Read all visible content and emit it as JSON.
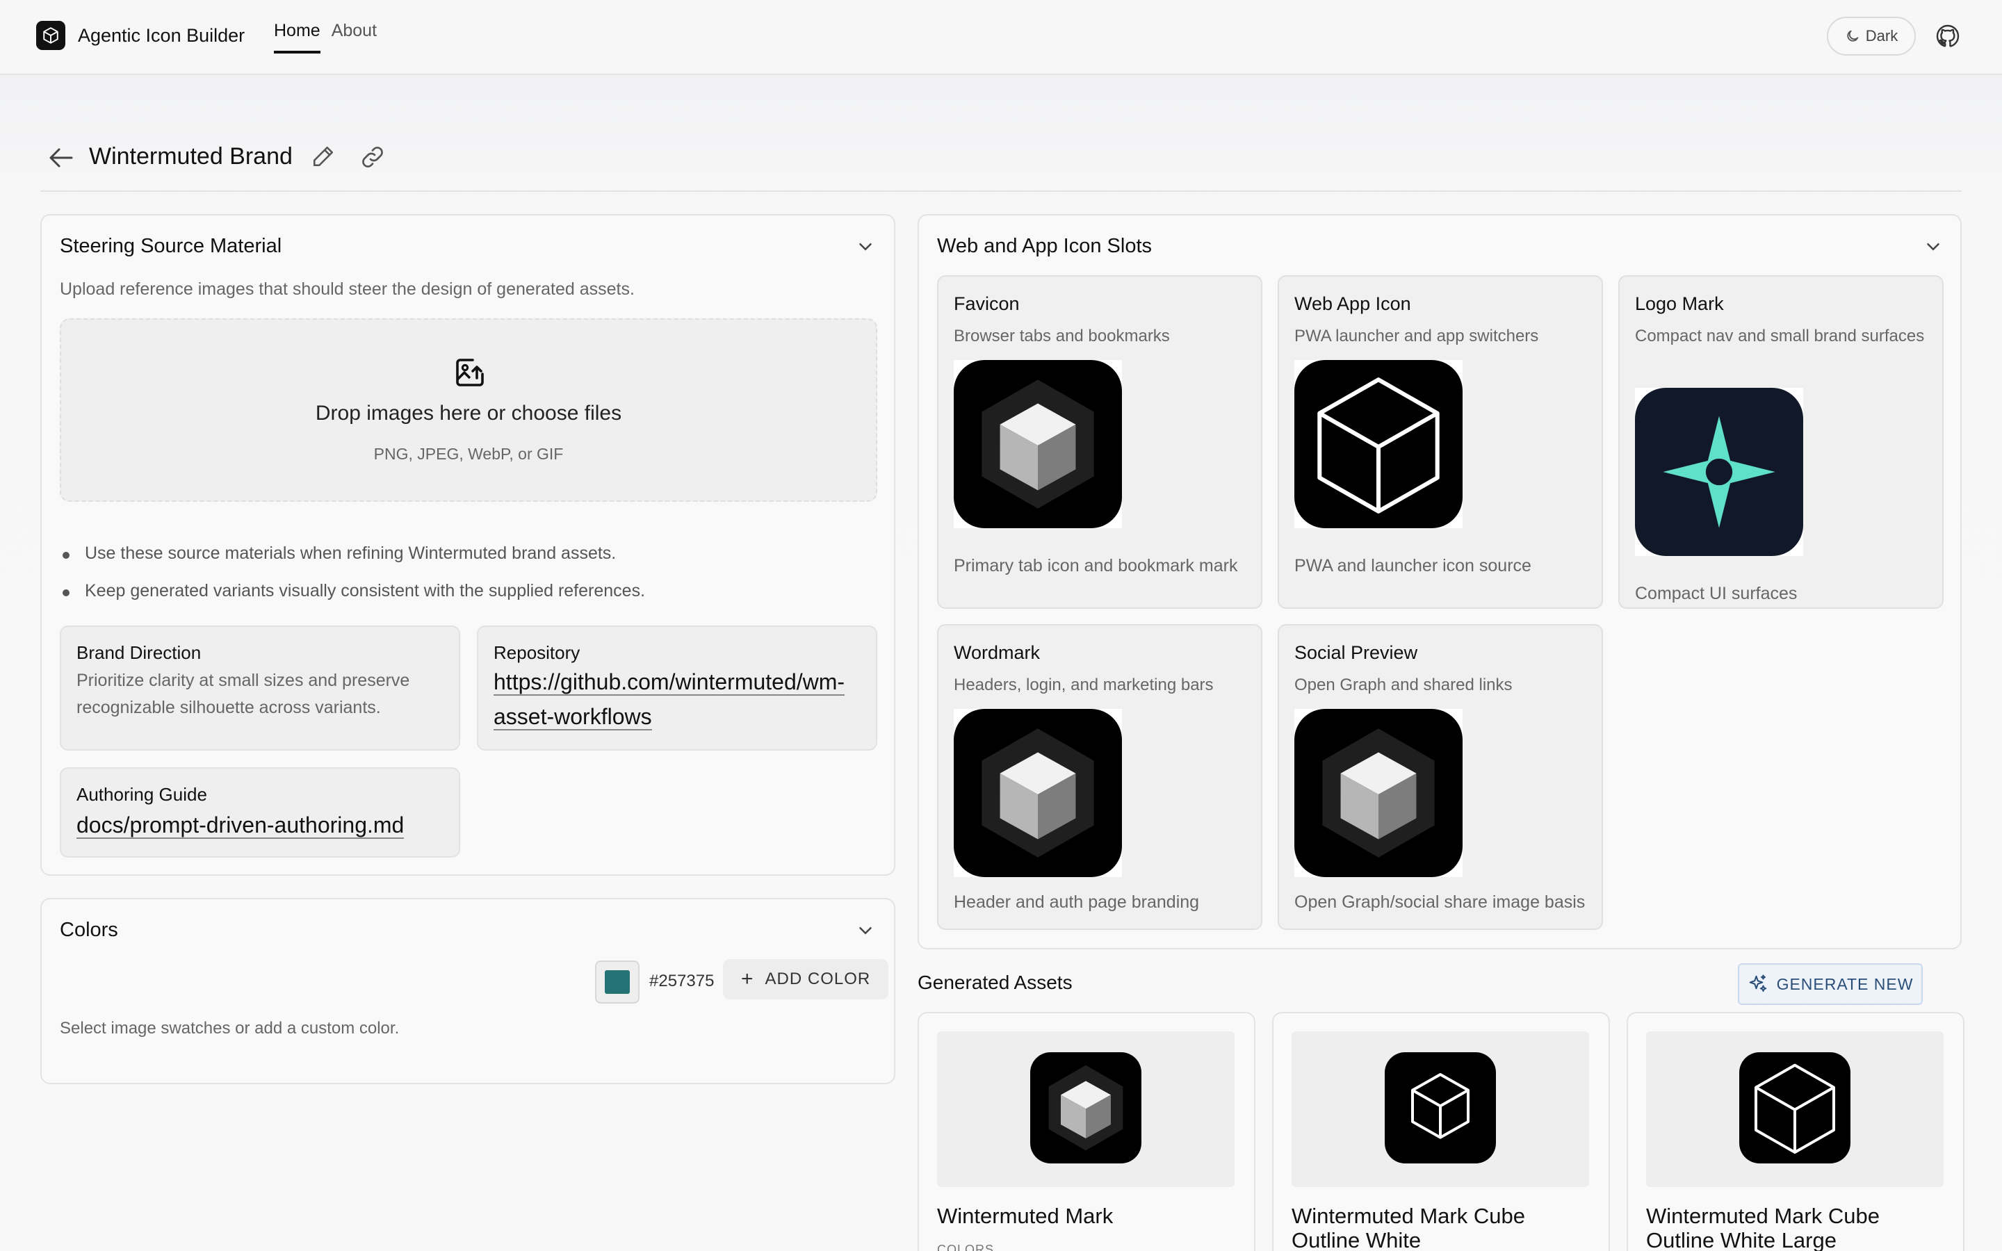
{
  "app": {
    "name": "Agentic Icon Builder",
    "nav": [
      {
        "label": "Home",
        "active": true
      },
      {
        "label": "About",
        "active": false
      }
    ],
    "theme_toggle": "Dark"
  },
  "page": {
    "title": "Wintermuted Brand"
  },
  "steering": {
    "title": "Steering Source Material",
    "subtitle": "Upload reference images that should steer the design of generated assets.",
    "dropzone": {
      "title": "Drop images here or choose files",
      "hint": "PNG, JPEG, WebP, or GIF"
    },
    "bullets": [
      "Use these source materials when refining Wintermuted brand assets.",
      "Keep generated variants visually consistent with the supplied references."
    ],
    "meta": {
      "brand_direction": {
        "label": "Brand Direction",
        "value_line1": "Prioritize clarity at small sizes and preserve",
        "value_line2": "recognizable silhouette across variants."
      },
      "repository": {
        "label": "Repository",
        "value_line1": "https://github.com/wintermuted/wm-",
        "value_line2": "asset-workflows"
      },
      "authoring_guide": {
        "label": "Authoring Guide",
        "value": "docs/prompt-driven-authoring.md"
      }
    }
  },
  "colors": {
    "title": "Colors",
    "swatch_color": "#257375",
    "swatch_hex": "#257375",
    "add_label": "ADD COLOR",
    "hint": "Select image swatches or add a custom color."
  },
  "slots": {
    "title": "Web and App Icon Slots",
    "items": [
      {
        "title": "Favicon",
        "subtitle": "Browser tabs and bookmarks",
        "caption": "Primary tab icon and bookmark mark",
        "icon": "shaded-cube-icon"
      },
      {
        "title": "Web App Icon",
        "subtitle": "PWA launcher and app switchers",
        "caption": "PWA and launcher icon source",
        "icon": "outline-cube-icon"
      },
      {
        "title": "Logo Mark",
        "subtitle": "Compact nav and small brand surfaces",
        "caption": "Compact UI surfaces",
        "icon": "compass-star-icon",
        "accent": "#5fe0c8",
        "bg": "#111827"
      },
      {
        "title": "Wordmark",
        "subtitle": "Headers, login, and marketing bars",
        "caption": "Header and auth page branding",
        "icon": "shaded-cube-icon"
      },
      {
        "title": "Social Preview",
        "subtitle": "Open Graph and shared links",
        "caption": "Open Graph/social share image basis",
        "icon": "shaded-cube-icon"
      }
    ]
  },
  "generated": {
    "title": "Generated Assets",
    "generate_label": "GENERATE NEW",
    "assets": [
      {
        "name_line1": "Wintermuted Mark",
        "name_line2": "",
        "meta": "COLORS"
      },
      {
        "name_line1": "Wintermuted Mark Cube",
        "name_line2": "Outline White",
        "meta": ""
      },
      {
        "name_line1": "Wintermuted Mark Cube",
        "name_line2": "Outline White Large",
        "meta": ""
      }
    ]
  }
}
